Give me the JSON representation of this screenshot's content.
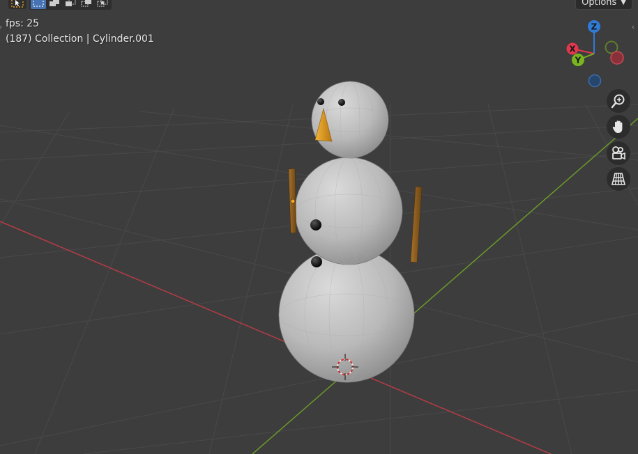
{
  "viewport": {
    "fps_label": "fps: 25",
    "object_info": "(187) Collection | Cylinder.001"
  },
  "header": {
    "options_label": "Options"
  },
  "gizmo": {
    "x_label": "X",
    "y_label": "Y",
    "z_label": "Z",
    "colors": {
      "x": "#e2384e",
      "y": "#7ab51f",
      "z": "#2f7bd6"
    }
  },
  "nav_icons": [
    "zoom-icon",
    "hand-pan-icon",
    "camera-view-icon",
    "grid-perspective-icon"
  ],
  "colors": {
    "background": "#3d3d3d",
    "grid": "#4a4a4a",
    "x_axis": "#b43c46",
    "y_axis": "#6a9a2a",
    "snow": "#c8c8c8",
    "carrot": "#e8a020",
    "stick": "#8a5a20",
    "button": "#111111"
  }
}
